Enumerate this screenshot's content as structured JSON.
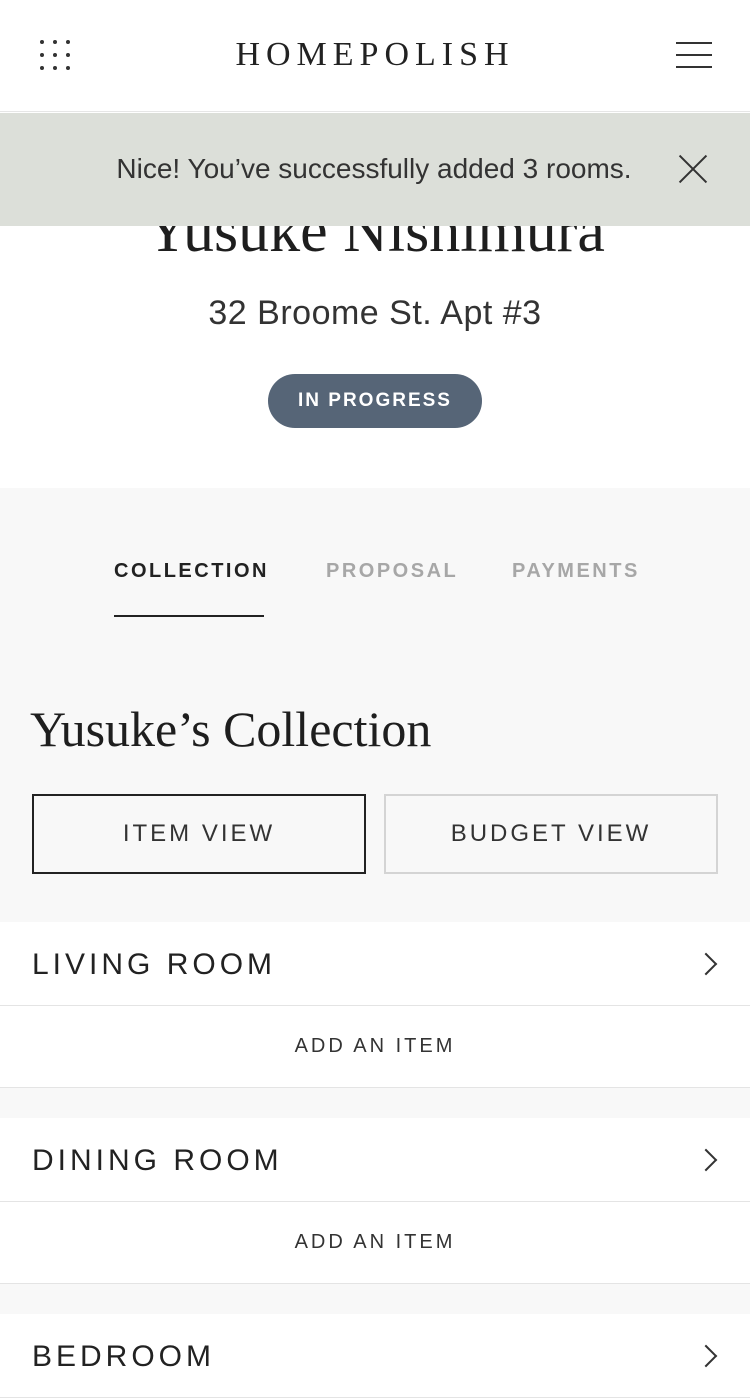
{
  "header": {
    "brand": "HOMEPOLISH",
    "grid_icon": "grid-icon",
    "menu_icon": "menu-icon"
  },
  "toast": {
    "message": "Nice! You’ve successfully added 3 rooms.",
    "close_icon": "close-icon"
  },
  "project": {
    "client_name": "Yusuke Nishimura",
    "address": "32 Broome St. Apt #3",
    "status": "IN PROGRESS",
    "status_color": "#566577"
  },
  "tabs": [
    {
      "label": "COLLECTION",
      "active": true
    },
    {
      "label": "PROPOSAL",
      "active": false
    },
    {
      "label": "PAYMENTS",
      "active": false
    }
  ],
  "collection": {
    "title": "Yusuke’s Collection",
    "item_view_label": "ITEM VIEW",
    "budget_view_label": "BUDGET VIEW",
    "active_view": "ITEM VIEW"
  },
  "rooms": [
    {
      "name": "LIVING ROOM",
      "add_label": "ADD AN ITEM"
    },
    {
      "name": "DINING ROOM",
      "add_label": "ADD AN ITEM"
    },
    {
      "name": "BEDROOM"
    }
  ],
  "colors": {
    "toast_bg": "#dcdfd9",
    "section_bg": "#f8f8f8",
    "inactive_tab": "#a7a7a7"
  }
}
